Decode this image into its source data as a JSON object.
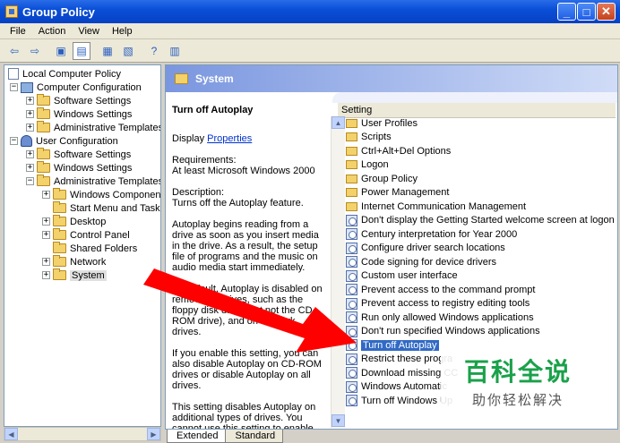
{
  "window": {
    "title": "Group Policy"
  },
  "menu": [
    "File",
    "Action",
    "View",
    "Help"
  ],
  "tree": {
    "items": [
      {
        "label": "Local Computer Policy",
        "level": 0,
        "icon": "document-icon",
        "expander": ""
      },
      {
        "label": "Computer Configuration",
        "level": 1,
        "icon": "computer-icon",
        "expander": "−"
      },
      {
        "label": "Software Settings",
        "level": 2,
        "icon": "folder-icon",
        "expander": "+"
      },
      {
        "label": "Windows Settings",
        "level": 2,
        "icon": "folder-icon",
        "expander": "+"
      },
      {
        "label": "Administrative Templates",
        "level": 2,
        "icon": "folder-icon",
        "expander": "+"
      },
      {
        "label": "User Configuration",
        "level": 1,
        "icon": "user-icon",
        "expander": "−"
      },
      {
        "label": "Software Settings",
        "level": 2,
        "icon": "folder-icon",
        "expander": "+"
      },
      {
        "label": "Windows Settings",
        "level": 2,
        "icon": "folder-icon",
        "expander": "+"
      },
      {
        "label": "Administrative Templates",
        "level": 2,
        "icon": "folder-icon",
        "expander": "−"
      },
      {
        "label": "Windows Components",
        "level": 3,
        "icon": "folder-icon",
        "expander": "+"
      },
      {
        "label": "Start Menu and Taskba",
        "level": 3,
        "icon": "folder-icon",
        "expander": ""
      },
      {
        "label": "Desktop",
        "level": 3,
        "icon": "folder-icon",
        "expander": "+"
      },
      {
        "label": "Control Panel",
        "level": 3,
        "icon": "folder-icon",
        "expander": "+"
      },
      {
        "label": "Shared Folders",
        "level": 3,
        "icon": "folder-icon",
        "expander": ""
      },
      {
        "label": "Network",
        "level": 3,
        "icon": "folder-icon",
        "expander": "+"
      },
      {
        "label": "System",
        "level": 3,
        "icon": "folder-open-icon",
        "expander": "+",
        "selected": true
      }
    ]
  },
  "right_header": {
    "title": "System"
  },
  "description": {
    "heading": "Turn off Autoplay",
    "display_prefix": "Display ",
    "properties_link": "Properties",
    "requirements_label": "Requirements:",
    "requirements_value": "At least Microsoft Windows 2000",
    "description_label": "Description:",
    "description_value": "Turns off the Autoplay feature.",
    "para1": "Autoplay begins reading from a drive as soon as you insert media in the drive. As a result, the setup file of programs and the music on audio media start immediately.",
    "para2": "By default, Autoplay is disabled on removable drives, such as the floppy disk drive (but not the CD-ROM drive), and on network drives.",
    "para3": "If you enable this setting, you can also disable Autoplay on CD-ROM drives or disable Autoplay on all drives.",
    "para4": "This setting disables Autoplay on additional types of drives. You cannot use this setting to enable Autoplay on drives on which it is disabled by"
  },
  "list": {
    "column_header": "Setting",
    "items": [
      {
        "label": "User Profiles",
        "type": "folder"
      },
      {
        "label": "Scripts",
        "type": "folder"
      },
      {
        "label": "Ctrl+Alt+Del Options",
        "type": "folder"
      },
      {
        "label": "Logon",
        "type": "folder"
      },
      {
        "label": "Group Policy",
        "type": "folder"
      },
      {
        "label": "Power Management",
        "type": "folder"
      },
      {
        "label": "Internet Communication Management",
        "type": "folder"
      },
      {
        "label": "Don't display the Getting Started welcome screen at logon",
        "type": "setting"
      },
      {
        "label": "Century interpretation for Year 2000",
        "type": "setting"
      },
      {
        "label": "Configure driver search locations",
        "type": "setting"
      },
      {
        "label": "Code signing for device drivers",
        "type": "setting"
      },
      {
        "label": "Custom user interface",
        "type": "setting"
      },
      {
        "label": "Prevent access to the command prompt",
        "type": "setting"
      },
      {
        "label": "Prevent access to registry editing tools",
        "type": "setting"
      },
      {
        "label": "Run only allowed Windows applications",
        "type": "setting"
      },
      {
        "label": "Don't run specified Windows applications",
        "type": "setting"
      },
      {
        "label": "Turn off Autoplay",
        "type": "setting",
        "selected": true
      },
      {
        "label": "Restrict these progra",
        "type": "setting"
      },
      {
        "label": "Download missing CC",
        "type": "setting"
      },
      {
        "label": "Windows Automatic",
        "type": "setting"
      },
      {
        "label": "Turn off Windows Up",
        "type": "setting"
      }
    ]
  },
  "tabs": [
    {
      "label": "Extended",
      "active": true
    },
    {
      "label": "Standard",
      "active": false
    }
  ],
  "watermark": {
    "big": "百科全说",
    "small": "助你轻松解决"
  },
  "colors": {
    "title_bar": "#0a4fd8",
    "selection": "#316ac5",
    "annotation_arrow": "#ff0000",
    "watermark_green": "#1aa14a"
  }
}
